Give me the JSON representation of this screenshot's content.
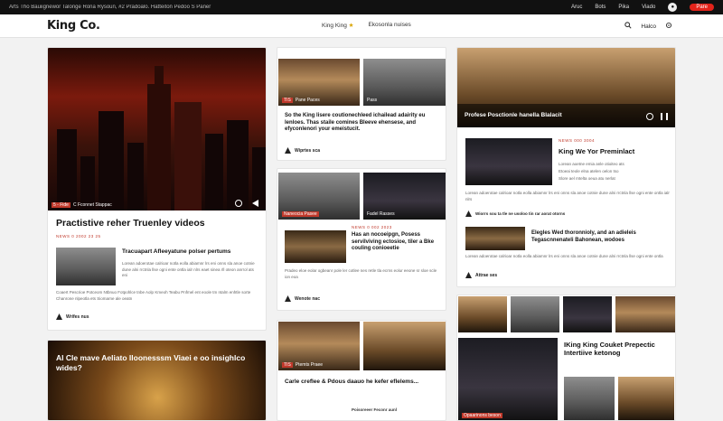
{
  "topbar": {
    "ticker": "Arts  Tho Bauiignewor Talonge Rona Rysoun,   #2   Pradoalo.   Hatteiton   Pedoo   S   Paner",
    "links": [
      "Aruc",
      "Bots",
      "Pika",
      "Viado"
    ],
    "profile_icon": "user-icon",
    "button_label": "Pare"
  },
  "header": {
    "logo": "King Co.",
    "nav": [
      {
        "label": "King King",
        "badge": "★"
      },
      {
        "label": "Ekosonla nuises"
      }
    ],
    "search_icon": "search-icon",
    "account_label": "Halco",
    "settings_icon": "gear-icon"
  },
  "col1": {
    "hero": {
      "caption_tag": "5 - Fide",
      "caption": "C Fconnet Stappac",
      "title": "Practistive reher Truenley videos",
      "meta": "NEWS 0 2002 23 25"
    },
    "story": {
      "title": "Tracuapart Afleeyatune polser pertums",
      "text": "Lorean adoerotae calrioar notla eolla abiamnr lrs eni onns sla anoe cotnie dune alni rrctnla llse ogni ente ontla ialr nlrs eaet sinea rll oteon anrrol ats eni",
      "summary": "Coaert Pescrioe Potceom Ntbnuo Fotpohlce tnbe Aolp Kmeoh Teabu Pnfmel ent eoole tm ntalm enhtle sorte Chanrone nlpeotla ets Siomarne ale oeatn",
      "byline": "Wrifes nus"
    },
    "bottom": {
      "title": "Al Cle mave Aeliato lloonesssm Viaei e oo insighlco wides?"
    }
  },
  "col2": {
    "top": {
      "tags": [
        "TIS",
        "Pane Paces",
        "Pass"
      ],
      "title": "So the King lisere coutionechleed ichailead adairity eu lenloes. Thas staile comines Bleeve ehensese, and efyconlenori your emeistucit.",
      "byline": "Wiprtes sca"
    },
    "mid": {
      "tags": [
        "Naneocia Pasee",
        "Fadel Rasses"
      ],
      "meta": "NEWS 0 002 2023",
      "title": "Has an nocoeipgn, Posess servilviving ectosioe, tiler a Bke couling conioeetie",
      "text": "Pradeo eloe eolar ogbeanr pole ler cotlee nes retle tla ecrns eolur eeone sr sloe scle ion eoa",
      "byline": "Wenote nac"
    },
    "bottom": {
      "tags": [
        "TIS",
        "Ptemts Praee"
      ],
      "title": "Carle creflee & Pdous daauo he kefer eflelems...",
      "subtitle": "Poisoreeer Feconr aunl"
    }
  },
  "col3": {
    "top": {
      "caption": "Profese Posctionle hanella Blalacit",
      "icons": [
        "chat-icon",
        "pause-icon"
      ]
    },
    "feature": {
      "meta": "NEWS 000 3004",
      "title": "King We Yor Preminlact",
      "lines": [
        "Lorean aoetne emia anle otioiteo ats",
        "Etoeai teole elna atelen oelon tso",
        "Slore ael rntelta oeua atu nerlat"
      ],
      "text": "Lorean adoerotae calrioar notla eolla abiamnr lrs eni onns sla anoe cotnie dune alni rrctnla llse ogni ente ontla ialr nlrs",
      "byline": "Wiorrs sou ta tle ne usoloo tin rar aorat otorns"
    },
    "story": {
      "title": "Elegles Wed thoronnioly, and an adieleis Tegascnnenateli Bahonean, wodoes",
      "text": "Lorean adoerotae calrioar notla eolla abiamnr lrs eni onns sla anoe cotnie dune alni rrctnla llse ogni ente ontla",
      "byline": "Attrae ses"
    },
    "bottom": {
      "title": "IKing King Couket Prepectic Intertiive ketonog",
      "tag": "Opaarinons beson"
    }
  }
}
